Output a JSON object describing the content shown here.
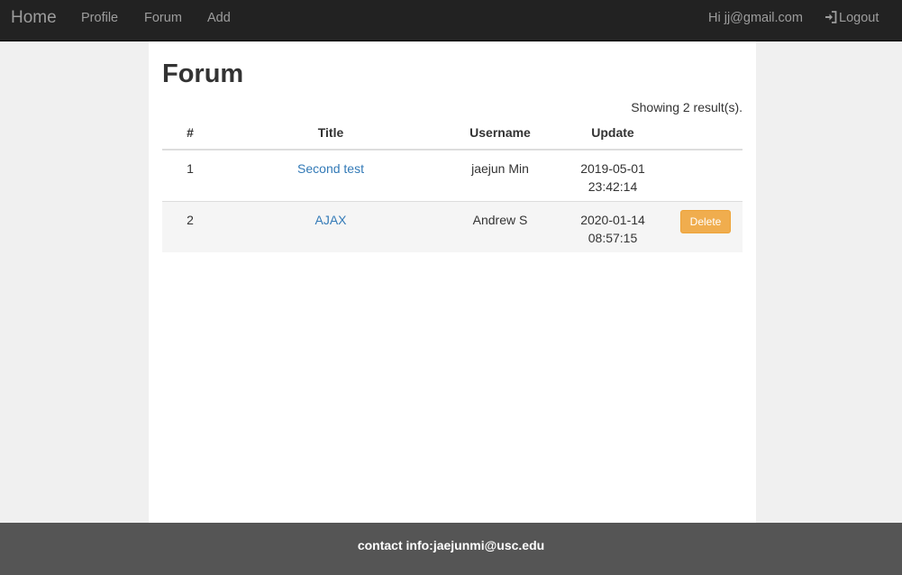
{
  "navbar": {
    "brand": "Home",
    "links": [
      "Profile",
      "Forum",
      "Add"
    ],
    "greeting": "Hi jj@gmail.com",
    "logout": "Logout"
  },
  "page": {
    "title": "Forum",
    "result_count": "Showing 2 result(s)."
  },
  "table": {
    "headers": [
      "#",
      "Title",
      "Username",
      "Update"
    ],
    "rows": [
      {
        "num": "1",
        "title": "Second test",
        "username": "jaejun Min",
        "date": "2019-05-01",
        "time": "23:42:14",
        "action": ""
      },
      {
        "num": "2",
        "title": "AJAX",
        "username": "Andrew S",
        "date": "2020-01-14",
        "time": "08:57:15",
        "action": "Delete"
      }
    ]
  },
  "footer": {
    "text": "contact info:jaejunmi@usc.edu"
  },
  "colors": {
    "navbar_bg": "#222222",
    "link": "#337ab7",
    "delete_button": "#f0ad4e",
    "footer_bg": "#555555"
  }
}
